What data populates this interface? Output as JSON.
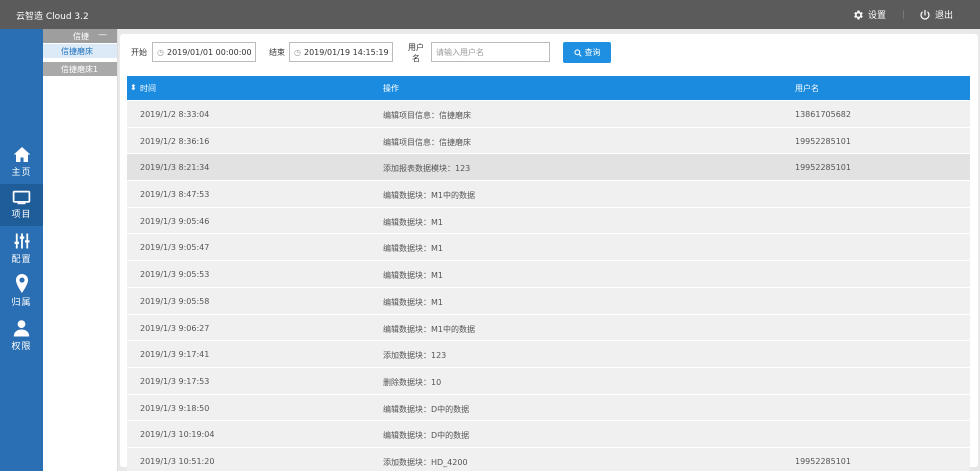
{
  "app": {
    "title": "云智造 Cloud 3.2"
  },
  "topbar": {
    "settings_label": "设置",
    "logout_label": "退出"
  },
  "leftnav": [
    {
      "label": "主页",
      "icon": "home-icon"
    },
    {
      "label": "项目",
      "icon": "monitor-icon"
    },
    {
      "label": "配置",
      "icon": "sliders-icon"
    },
    {
      "label": "归属",
      "icon": "map-pin-icon"
    },
    {
      "label": "权限",
      "icon": "user-icon"
    }
  ],
  "submenu": {
    "header": "信捷",
    "collapse_symbol": "—",
    "items": [
      "信捷磨床",
      "信捷磨床1"
    ]
  },
  "filter": {
    "start_label": "开始",
    "start_value": "2019/01/01 00:00:00",
    "end_label": "结束",
    "end_value": "2019/01/19 14:15:19",
    "user_label_1": "用户",
    "user_label_2": "名",
    "user_placeholder": "请输入用户名",
    "query_label": "查询"
  },
  "table": {
    "headers": {
      "time": "时间",
      "op": "操作",
      "user": "用户名"
    },
    "rows": [
      {
        "time": "2019/1/2 8:33:04",
        "op": "编辑项目信息：信捷磨床",
        "user": "13861705682"
      },
      {
        "time": "2019/1/2 8:36:16",
        "op": "编辑项目信息：信捷磨床",
        "user": "19952285101"
      },
      {
        "time": "2019/1/3 8:21:34",
        "op": "添加报表数据模块：123",
        "user": "19952285101"
      },
      {
        "time": "2019/1/3 8:47:53",
        "op": "编辑数据块：M1中的数据",
        "user": ""
      },
      {
        "time": "2019/1/3 9:05:46",
        "op": "编辑数据块：M1",
        "user": ""
      },
      {
        "time": "2019/1/3 9:05:47",
        "op": "编辑数据块：M1",
        "user": ""
      },
      {
        "time": "2019/1/3 9:05:53",
        "op": "编辑数据块：M1",
        "user": ""
      },
      {
        "time": "2019/1/3 9:05:58",
        "op": "编辑数据块：M1",
        "user": ""
      },
      {
        "time": "2019/1/3 9:06:27",
        "op": "编辑数据块：M1中的数据",
        "user": ""
      },
      {
        "time": "2019/1/3 9:17:41",
        "op": "添加数据块：123",
        "user": ""
      },
      {
        "time": "2019/1/3 9:17:53",
        "op": "删除数据块：10",
        "user": ""
      },
      {
        "time": "2019/1/3 9:18:50",
        "op": "编辑数据块：D中的数据",
        "user": ""
      },
      {
        "time": "2019/1/3 10:19:04",
        "op": "编辑数据块：D中的数据",
        "user": ""
      },
      {
        "time": "2019/1/3 10:51:20",
        "op": "添加数据块：HD_4200",
        "user": "19952285101"
      }
    ]
  },
  "colors": {
    "accent": "#1b8be0",
    "nav": "#2a6fb3",
    "topbar": "#5b5b5b"
  }
}
